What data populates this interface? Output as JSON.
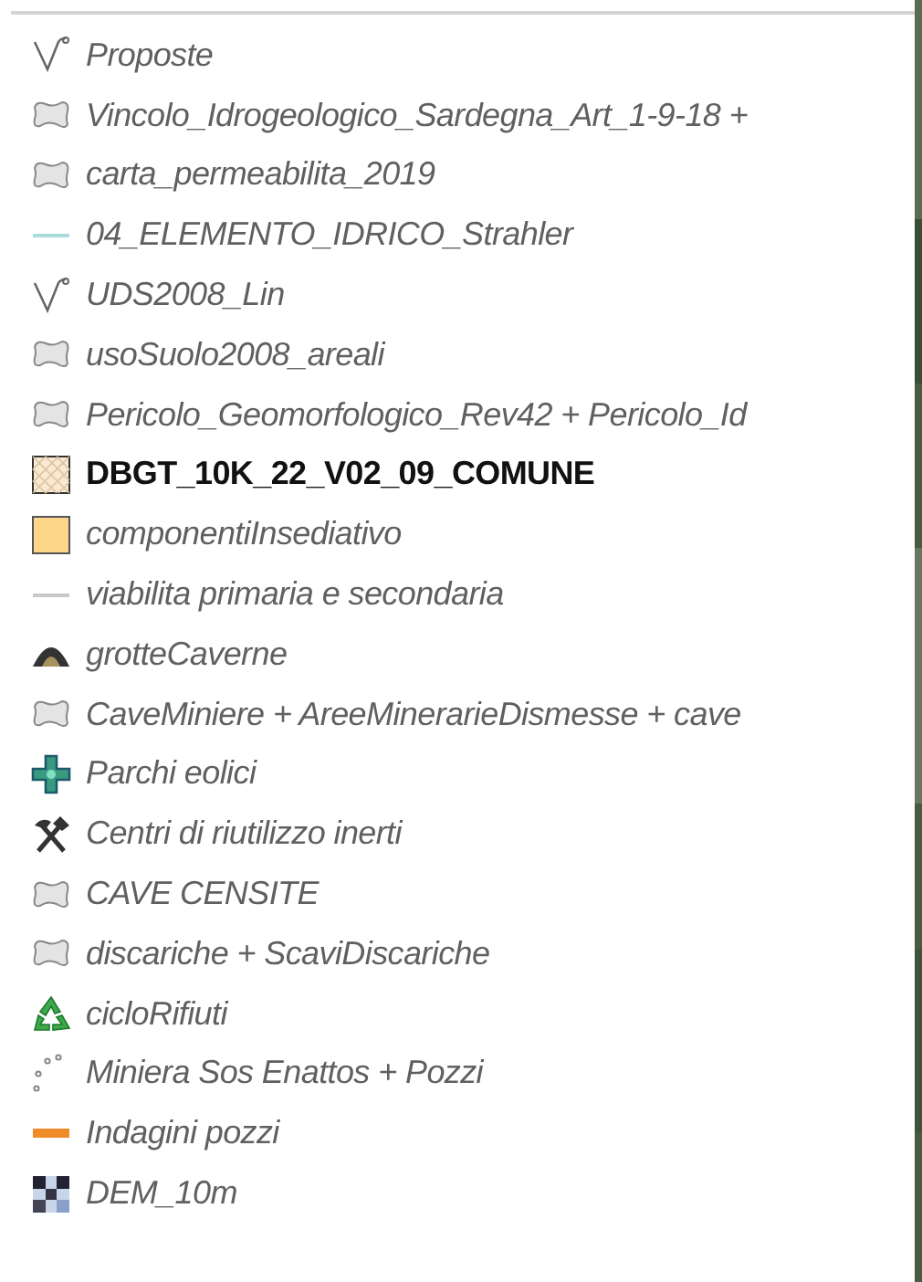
{
  "layers": [
    {
      "label": "Proposte",
      "kind": "vertex",
      "active": false
    },
    {
      "label": "Vincolo_Idrogeologico_Sardegna_Art_1-9-18 +",
      "kind": "polygon",
      "active": false
    },
    {
      "label": "carta_permeabilita_2019",
      "kind": "polygon",
      "active": false
    },
    {
      "label": "04_ELEMENTO_IDRICO_Strahler",
      "kind": "line",
      "color": "#a8dcdc",
      "active": false
    },
    {
      "label": "UDS2008_Lin",
      "kind": "vertex",
      "active": false
    },
    {
      "label": "usoSuolo2008_areali",
      "kind": "polygon",
      "active": false
    },
    {
      "label": "Pericolo_Geomorfologico_Rev42 + Pericolo_Id",
      "kind": "polygon",
      "active": false
    },
    {
      "label": "DBGT_10K_22_V02_09_COMUNE",
      "kind": "hatched",
      "active": true
    },
    {
      "label": "componentiInsediativo",
      "kind": "fill",
      "color": "#fdd68a",
      "active": false
    },
    {
      "label": "viabilita primaria e secondaria",
      "kind": "line",
      "color": "#c8c8c8",
      "active": false
    },
    {
      "label": "grotteCaverne",
      "kind": "cave",
      "active": false
    },
    {
      "label": "CaveMiniere + AreeMinerarieDismesse + cave",
      "kind": "polygon",
      "active": false
    },
    {
      "label": "Parchi eolici",
      "kind": "cross",
      "active": false
    },
    {
      "label": "Centri di riutilizzo inerti",
      "kind": "tools",
      "active": false
    },
    {
      "label": "CAVE CENSITE",
      "kind": "polygon",
      "active": false
    },
    {
      "label": "discariche + ScaviDiscariche",
      "kind": "polygon",
      "active": false
    },
    {
      "label": "cicloRifiuti",
      "kind": "recycle",
      "active": false
    },
    {
      "label": "Miniera Sos Enattos + Pozzi",
      "kind": "dots",
      "active": false
    },
    {
      "label": "Indagini pozzi",
      "kind": "line",
      "color": "#f08c28",
      "active": false
    },
    {
      "label": "DEM_10m",
      "kind": "raster",
      "active": false
    }
  ]
}
